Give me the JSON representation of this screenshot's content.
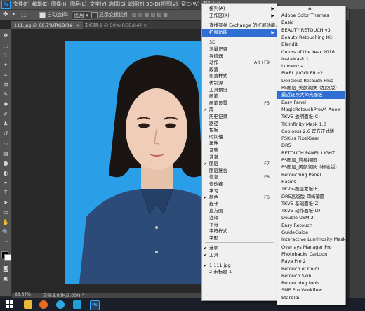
{
  "menubar": {
    "items": [
      "文件(F)",
      "编辑(E)",
      "图像(I)",
      "图层(L)",
      "文字(Y)",
      "选择(S)",
      "滤镜(T)",
      "3D(D)",
      "视图(V)",
      "窗口(W)",
      "帮助(H)"
    ]
  },
  "options": {
    "autoselect_label": "自动选择:",
    "layer_select": "图层",
    "transform_label": "显示变换控件"
  },
  "tabs": [
    {
      "label": "111.jpg @ 66.7%(RGB/8#)"
    },
    {
      "label": "未标题-1 @ 50%(RGB/8#)"
    }
  ],
  "status": {
    "zoom": "66.67%",
    "doc": "文档:3.00M/3.00M"
  },
  "window_menu": {
    "items": [
      {
        "label": "排列(A)",
        "submenu": true
      },
      {
        "label": "工作区(K)",
        "submenu": true
      },
      {
        "sep": true
      },
      {
        "label": "查找有关 Exchange 的扩展功能..."
      },
      {
        "label": "扩展功能",
        "submenu": true,
        "highlight": true
      },
      {
        "sep": true
      },
      {
        "label": "3D"
      },
      {
        "label": "测量记录"
      },
      {
        "label": "导航器"
      },
      {
        "label": "动作",
        "shortcut": "Alt+F9"
      },
      {
        "label": "段落"
      },
      {
        "label": "段落样式"
      },
      {
        "label": "仿制源"
      },
      {
        "label": "工具预设"
      },
      {
        "label": "画笔"
      },
      {
        "label": "画笔设置",
        "shortcut": "F5"
      },
      {
        "label": "库",
        "check": true
      },
      {
        "label": "历史记录"
      },
      {
        "label": "路径"
      },
      {
        "label": "色板"
      },
      {
        "label": "时间轴"
      },
      {
        "label": "属性"
      },
      {
        "label": "调整"
      },
      {
        "label": "通道"
      },
      {
        "label": "图层",
        "shortcut": "F7",
        "check": true
      },
      {
        "label": "图层复合"
      },
      {
        "label": "信息",
        "shortcut": "F8"
      },
      {
        "label": "修改键"
      },
      {
        "label": "学习"
      },
      {
        "label": "颜色",
        "shortcut": "F6",
        "check": true
      },
      {
        "label": "样式"
      },
      {
        "label": "直方图"
      },
      {
        "label": "注释"
      },
      {
        "label": "字符"
      },
      {
        "label": "字符样式"
      },
      {
        "label": "字形"
      },
      {
        "sep": true
      },
      {
        "label": "选项",
        "check": true
      },
      {
        "label": "工具",
        "check": true
      },
      {
        "sep": true
      },
      {
        "label": "1 111.jpg",
        "check": true
      },
      {
        "label": "2 未标题-1"
      }
    ]
  },
  "extensions_menu": {
    "items": [
      {
        "label": "Adobe Color Themes"
      },
      {
        "label": "Basic"
      },
      {
        "label": "BEAUTY RETOUCH v3"
      },
      {
        "label": "Beauty Retouching Kit"
      },
      {
        "label": "Blendit"
      },
      {
        "label": "Colors of the Year 2016"
      },
      {
        "label": "InstaMask 1"
      },
      {
        "label": "Lumenzia"
      },
      {
        "label": "PIXEL JUGGLER v2"
      },
      {
        "label": "Delicious Retouch Plus"
      },
      {
        "label": "PS图层_美颜润肤（加强版）"
      },
      {
        "label": "最近证照大师光面板",
        "highlight": true
      },
      {
        "label": "Easy Panel"
      },
      {
        "label": "MagicRetouchProV4-Anew"
      },
      {
        "label": "TKV5-透明面板(C)"
      },
      {
        "label": "TK Infinity Mask 1.0"
      },
      {
        "label": "Coolorus 2.6 官方正式版"
      },
      {
        "label": "PSKiss PixelGear"
      },
      {
        "label": "DR5"
      },
      {
        "label": "RETOUCH PANEL LIGHT"
      },
      {
        "label": "PS图层_简易抠图"
      },
      {
        "label": "PS图层_美颜润肤（标准版）"
      },
      {
        "label": "Retouching Panel"
      },
      {
        "label": "Basics"
      },
      {
        "label": "TKV5-图层蒙板(E)"
      },
      {
        "label": "DR5高级版-四屿蜀圆"
      },
      {
        "label": "TKV5-基础面板(Z)"
      },
      {
        "label": "TKV5-动作面板(D)"
      },
      {
        "label": "Double USM 2"
      },
      {
        "label": "Easy Retouch"
      },
      {
        "label": "GuideGuide"
      },
      {
        "label": "Interactive Luminosity Masks"
      },
      {
        "label": "Overlays Manager Pro"
      },
      {
        "label": "Photobacks Cartoon"
      },
      {
        "label": "Raya Pro 2"
      },
      {
        "label": "Retouch of Color"
      },
      {
        "label": "Retouch Skin"
      },
      {
        "label": "Retouching tools"
      },
      {
        "label": "SMP Pro Workflow"
      },
      {
        "label": "StarsTail"
      }
    ]
  },
  "colors": {
    "accent": "#2f6fd1",
    "photo_bg": "#2b9ee8",
    "chrome": "#535353"
  }
}
